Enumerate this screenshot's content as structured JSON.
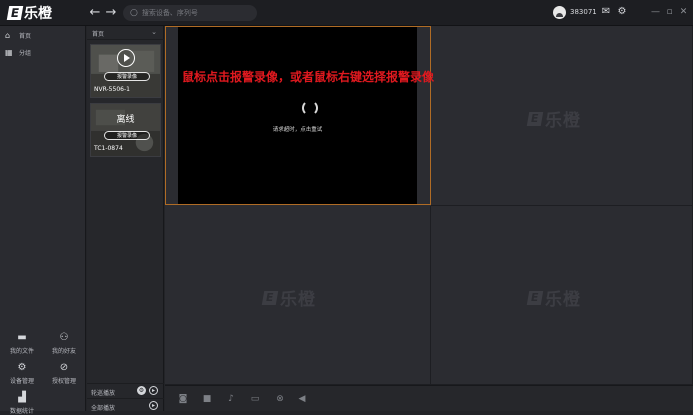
{
  "app": {
    "logo_text": "乐橙",
    "logo_mark": "E"
  },
  "titlebar": {
    "back_icon": "arrow-left-icon",
    "forward_icon": "arrow-right-icon",
    "search_placeholder": "搜索设备、序列号",
    "user_id": "383071",
    "mail_icon": "mail-icon",
    "settings_icon": "gear-icon"
  },
  "sidebar": {
    "items": [
      {
        "label": "首页",
        "icon": "home-icon"
      },
      {
        "label": "分组",
        "icon": "grid-icon"
      }
    ],
    "tools": [
      {
        "label": "我的文件",
        "icon": "folder-icon"
      },
      {
        "label": "我的好友",
        "icon": "friends-icon"
      },
      {
        "label": "设备管理",
        "icon": "device-manage-icon"
      },
      {
        "label": "授权管理",
        "icon": "authorize-icon"
      },
      {
        "label": "数据统计",
        "icon": "stats-icon"
      }
    ]
  },
  "devices": {
    "header": "首页",
    "list": [
      {
        "name": "NVR-5506-1",
        "tag": "报警录像",
        "status": "online"
      },
      {
        "name": "TC1-0874",
        "tag": "报警录像",
        "status": "离线"
      }
    ],
    "footer_loop": "轮巡播放",
    "footer_all": "全部播放"
  },
  "player": {
    "loading_text": "请求超时，点击重试",
    "annotation": "鼠标点击报警录像，或者鼠标右键选择报警录像",
    "watermark": "乐橙"
  },
  "colors": {
    "active_border": "#b06c25",
    "annotation": "#e0191f",
    "background": "#232428"
  }
}
